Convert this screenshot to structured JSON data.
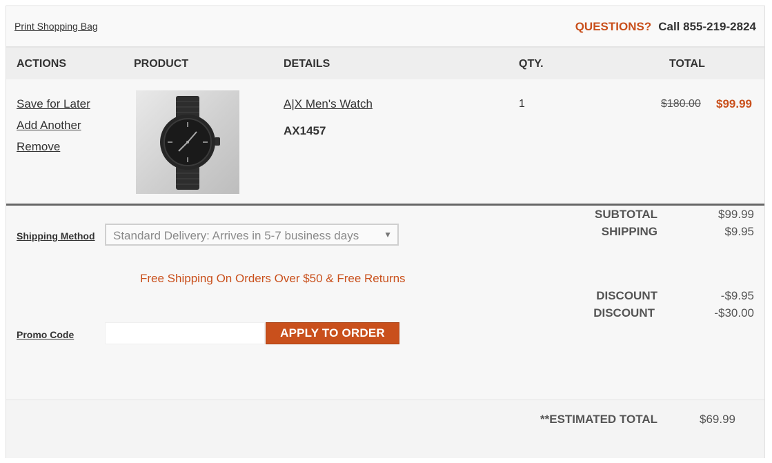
{
  "topbar": {
    "print_link": "Print Shopping Bag",
    "questions_label": "QUESTIONS?",
    "phone_text": "Call 855-219-2824"
  },
  "columns": {
    "actions": "ACTIONS",
    "product": "PRODUCT",
    "details": "DETAILS",
    "qty": "QTY.",
    "total": "TOTAL"
  },
  "item": {
    "actions": [
      "Save for Later",
      "Add Another",
      "Remove"
    ],
    "name": "A|X Men's Watch",
    "sku": "AX1457",
    "qty": "1",
    "original_price": "$180.00",
    "sale_price": "$99.99"
  },
  "shipping": {
    "label": "Shipping Method",
    "selected": "Standard Delivery: Arrives in 5-7 business days",
    "promo_text": "Free Shipping On Orders Over $50 & Free Returns"
  },
  "promo": {
    "label": "Promo Code",
    "placeholder": "",
    "apply_label": "APPLY TO ORDER"
  },
  "summary": {
    "subtotal_label": "SUBTOTAL",
    "subtotal_value": "$99.99",
    "shipping_label": "SHIPPING",
    "shipping_value": "$9.95",
    "discount1_label": "DISCOUNT",
    "discount1_value": "-$9.95",
    "discount2_label": "DISCOUNT",
    "discount2_value": "-$30.00",
    "estimated_label": "**ESTIMATED TOTAL",
    "estimated_value": "$69.99"
  },
  "colors": {
    "accent": "#c9501c",
    "text": "#333333",
    "header_bg": "#eeeeee"
  },
  "icons": {
    "dropdown": "chevron-down-icon",
    "product": "watch-image"
  }
}
